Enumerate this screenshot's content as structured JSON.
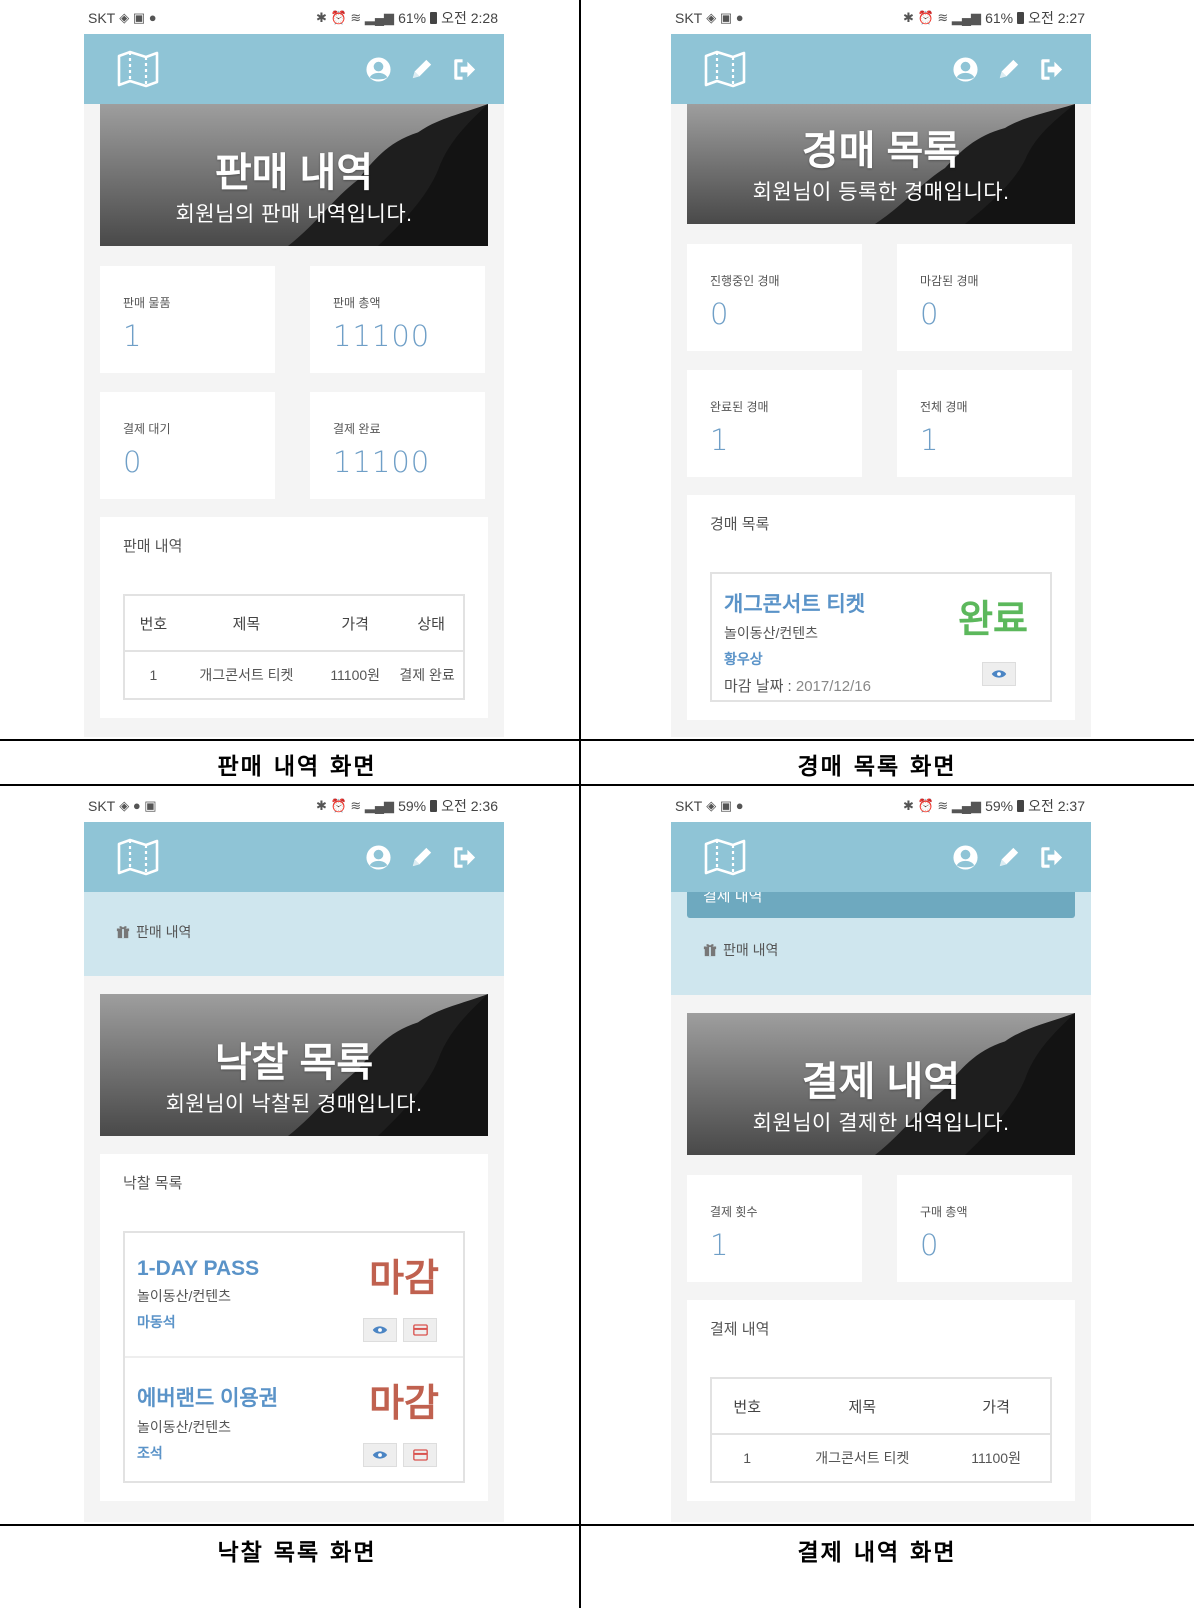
{
  "captions": {
    "sales": "판매 내역 화면",
    "auctions": "경매 목록 화면",
    "won": "낙찰 목록 화면",
    "payments": "결제 내역 화면"
  },
  "status_bars": {
    "sales": {
      "carrier": "SKT",
      "battery": "61%",
      "time": "오전 2:28"
    },
    "auctions": {
      "carrier": "SKT",
      "battery": "61%",
      "time": "오전 2:27"
    },
    "won": {
      "carrier": "SKT",
      "battery": "59%",
      "time": "오전 2:36"
    },
    "payments": {
      "carrier": "SKT",
      "battery": "59%",
      "time": "오전 2:37"
    }
  },
  "nav": {
    "icons": [
      "map-logo-icon",
      "user-circle-icon",
      "pencil-icon",
      "sign-out-icon"
    ]
  },
  "sales": {
    "hero_title": "판매 내역",
    "hero_sub": "회원님의 판매 내역입니다.",
    "cards": [
      {
        "label": "판매 물품",
        "value": "1"
      },
      {
        "label": "판매 총액",
        "value": "11100"
      },
      {
        "label": "결제 대기",
        "value": "0"
      },
      {
        "label": "결제 완료",
        "value": "11100"
      }
    ],
    "section_title": "판매 내역",
    "table": {
      "headers": [
        "번호",
        "제목",
        "가격",
        "상태"
      ],
      "rows": [
        [
          "1",
          "개그콘서트 티켓",
          "11100원",
          "결제 완료"
        ]
      ]
    }
  },
  "auctions": {
    "hero_title": "경매 목록",
    "hero_sub": "회원님이 등록한 경매입니다.",
    "cards": [
      {
        "label": "진행중인 경매",
        "value": "0"
      },
      {
        "label": "마감된 경매",
        "value": "0"
      },
      {
        "label": "완료된 경매",
        "value": "1"
      },
      {
        "label": "전체 경매",
        "value": "1"
      }
    ],
    "section_title": "경매 목록",
    "item": {
      "title": "개그콘서트 티켓",
      "category": "놀이동산/컨텐츠",
      "seller": "황우상",
      "deadline_label": "마감 날짜 : ",
      "deadline_value": "2017/12/16",
      "status": "완료"
    }
  },
  "won": {
    "breadcrumb": "판매 내역",
    "hero_title": "낙찰 목록",
    "hero_sub": "회원님이 낙찰된 경매입니다.",
    "section_title": "낙찰 목록",
    "items": [
      {
        "title": "1-DAY PASS",
        "category": "놀이동산/컨텐츠",
        "seller": "마동석",
        "status": "마감"
      },
      {
        "title": "에버랜드 이용권",
        "category": "놀이동산/컨텐츠",
        "seller": "조석",
        "status": "마감"
      }
    ]
  },
  "payments": {
    "prev_breadcrumb": "결제 내역",
    "breadcrumb": "판매 내역",
    "hero_title": "결제 내역",
    "hero_sub": "회원님이 결제한 내역입니다.",
    "cards": [
      {
        "label": "결제 횟수",
        "value": "1"
      },
      {
        "label": "구매 총액",
        "value": "0"
      }
    ],
    "section_title": "결제 내역",
    "table": {
      "headers": [
        "번호",
        "제목",
        "가격"
      ],
      "rows": [
        [
          "1",
          "개그콘서트 티켓",
          "11100원"
        ]
      ]
    }
  },
  "colors": {
    "navbar": "#8fc4d6",
    "value_blue": "#6f9fc7",
    "status_done": "#5cb85c",
    "status_closed": "#c0614f",
    "breadcrumb_bg": "#cfe6ee"
  }
}
